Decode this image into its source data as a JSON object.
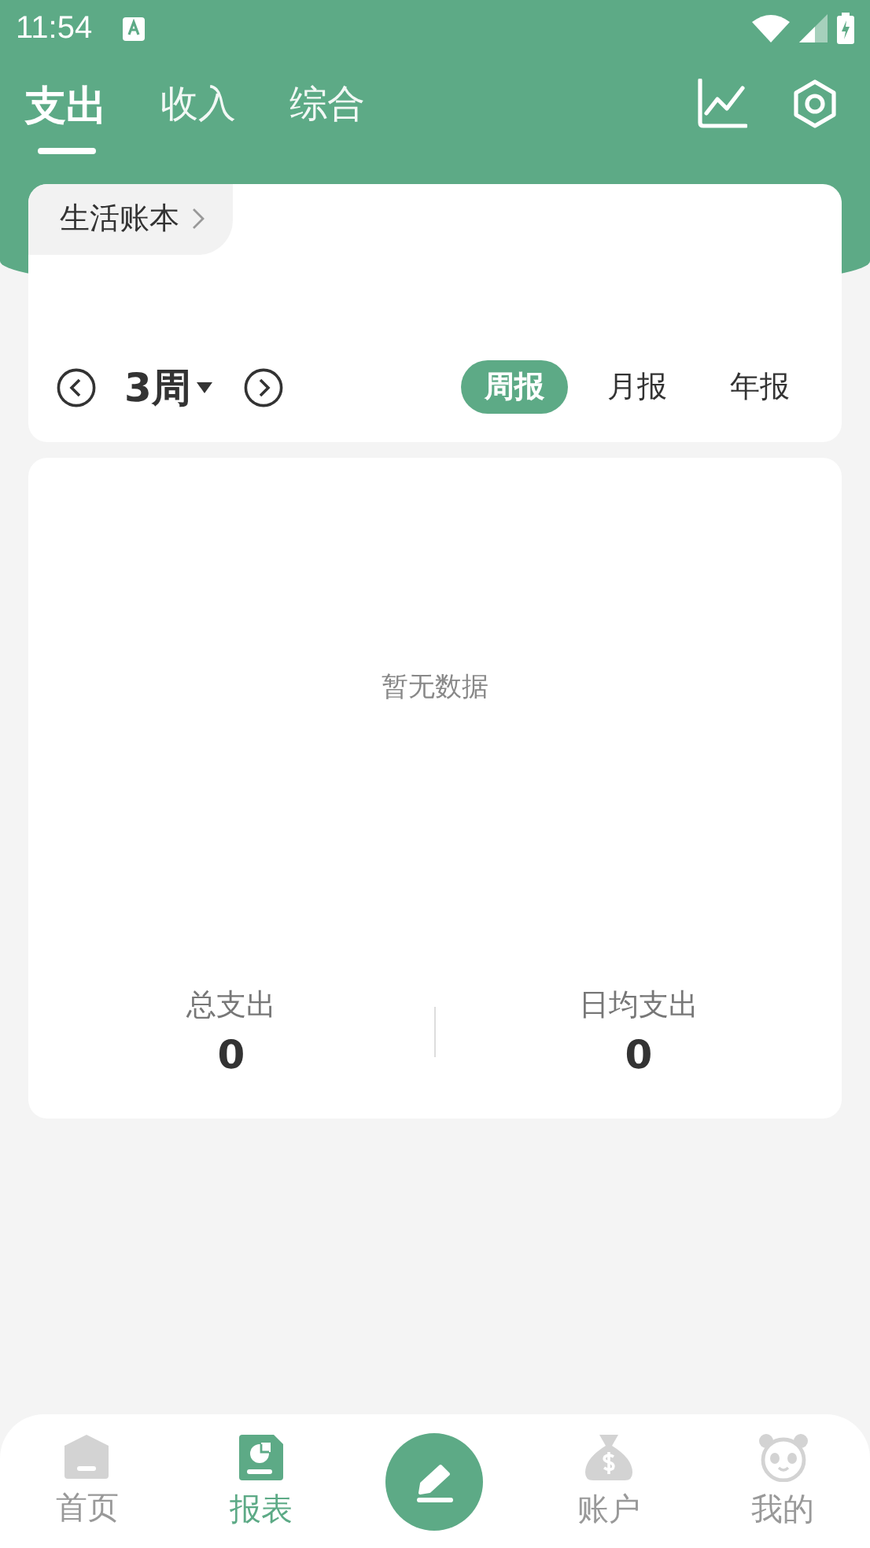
{
  "status_bar": {
    "time": "11:54"
  },
  "header": {
    "tabs": [
      {
        "label": "支出",
        "selected": true
      },
      {
        "label": "收入",
        "selected": false
      },
      {
        "label": "综合",
        "selected": false
      }
    ]
  },
  "book": {
    "label": "生活账本"
  },
  "period": {
    "label": "3周",
    "reports": [
      {
        "label": "周报",
        "selected": true
      },
      {
        "label": "月报",
        "selected": false
      },
      {
        "label": "年报",
        "selected": false
      }
    ]
  },
  "summary": {
    "empty_text": "暂无数据",
    "stats": [
      {
        "label": "总支出",
        "value": "0"
      },
      {
        "label": "日均支出",
        "value": "0"
      }
    ]
  },
  "bottom_nav": [
    {
      "kind": "home",
      "label": "首页",
      "selected": false
    },
    {
      "kind": "report",
      "label": "报表",
      "selected": true
    },
    {
      "kind": "add"
    },
    {
      "kind": "account",
      "label": "账户",
      "selected": false
    },
    {
      "kind": "profile",
      "label": "我的",
      "selected": false
    }
  ]
}
